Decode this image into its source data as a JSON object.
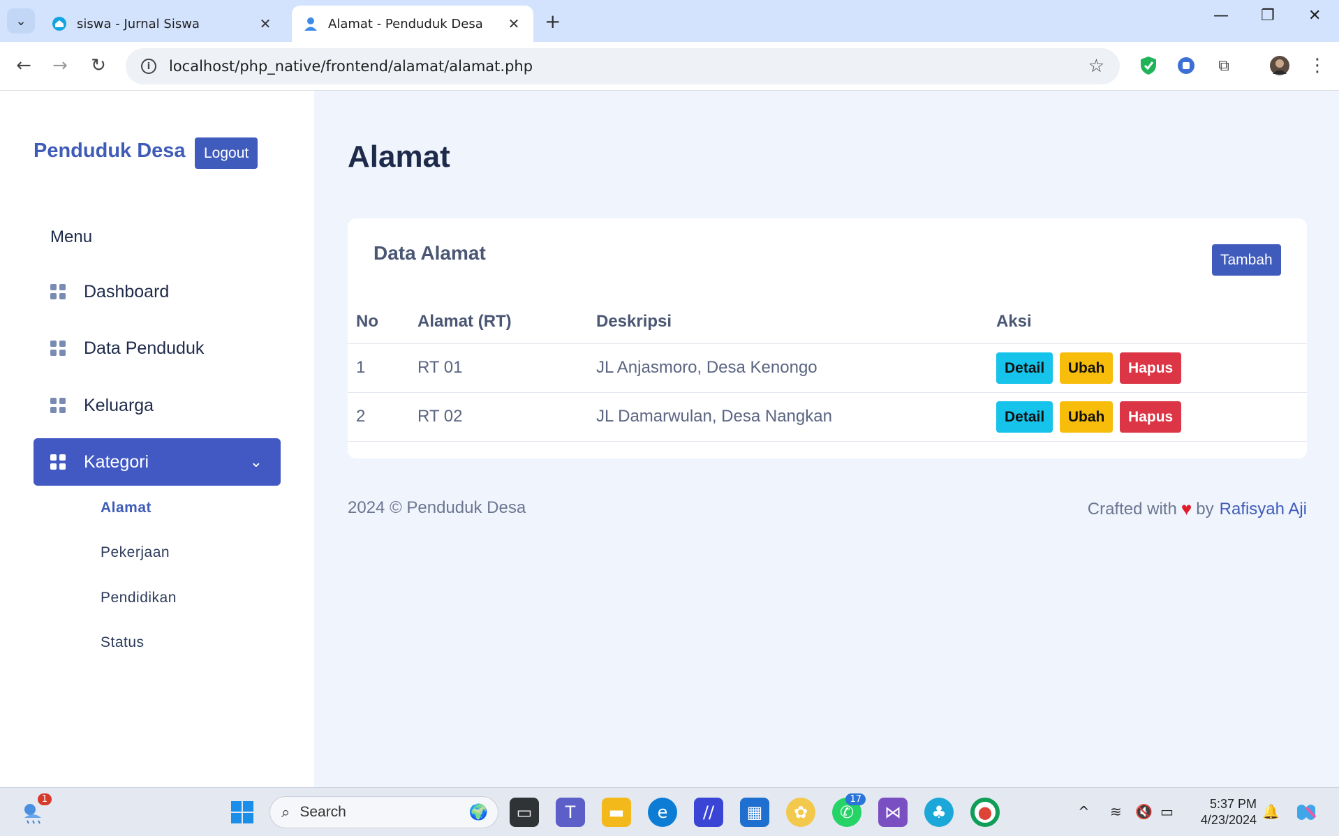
{
  "browser": {
    "tabs": [
      {
        "title": "siswa - Jurnal Siswa",
        "active": false
      },
      {
        "title": "Alamat - Penduduk Desa",
        "active": true
      }
    ],
    "url": "localhost/php_native/frontend/alamat/alamat.php"
  },
  "sidebar": {
    "brand": "Penduduk Desa",
    "logout_label": "Logout",
    "menu_heading": "Menu",
    "items": [
      {
        "label": "Dashboard"
      },
      {
        "label": "Data Penduduk"
      },
      {
        "label": "Keluarga"
      },
      {
        "label": "Kategori"
      }
    ],
    "subitems": [
      {
        "label": "Alamat"
      },
      {
        "label": "Pekerjaan"
      },
      {
        "label": "Pendidikan"
      },
      {
        "label": "Status"
      }
    ]
  },
  "main": {
    "title": "Alamat",
    "card_title": "Data Alamat",
    "add_label": "Tambah",
    "columns": [
      "No",
      "Alamat (RT)",
      "Deskripsi",
      "Aksi"
    ],
    "rows": [
      {
        "no": "1",
        "alamat": "RT 01",
        "deskripsi": "JL Anjasmoro, Desa Kenongo"
      },
      {
        "no": "2",
        "alamat": "RT 02",
        "deskripsi": "JL Damarwulan, Desa Nangkan"
      }
    ],
    "actions": {
      "detail": "Detail",
      "ubah": "Ubah",
      "hapus": "Hapus"
    },
    "colors": {
      "primary": "#3f5bbc",
      "info": "#16c3ea",
      "warning": "#f7bd0a",
      "danger": "#dc3545"
    }
  },
  "footer": {
    "copyright": "2024 © Penduduk Desa",
    "crafted": "Crafted with",
    "by": "by",
    "author": "Rafisyah Aji"
  },
  "taskbar": {
    "search_placeholder": "Search",
    "weather_badge": "1",
    "whatsapp_badge": "17",
    "time": "5:37 PM",
    "date": "4/23/2024"
  }
}
